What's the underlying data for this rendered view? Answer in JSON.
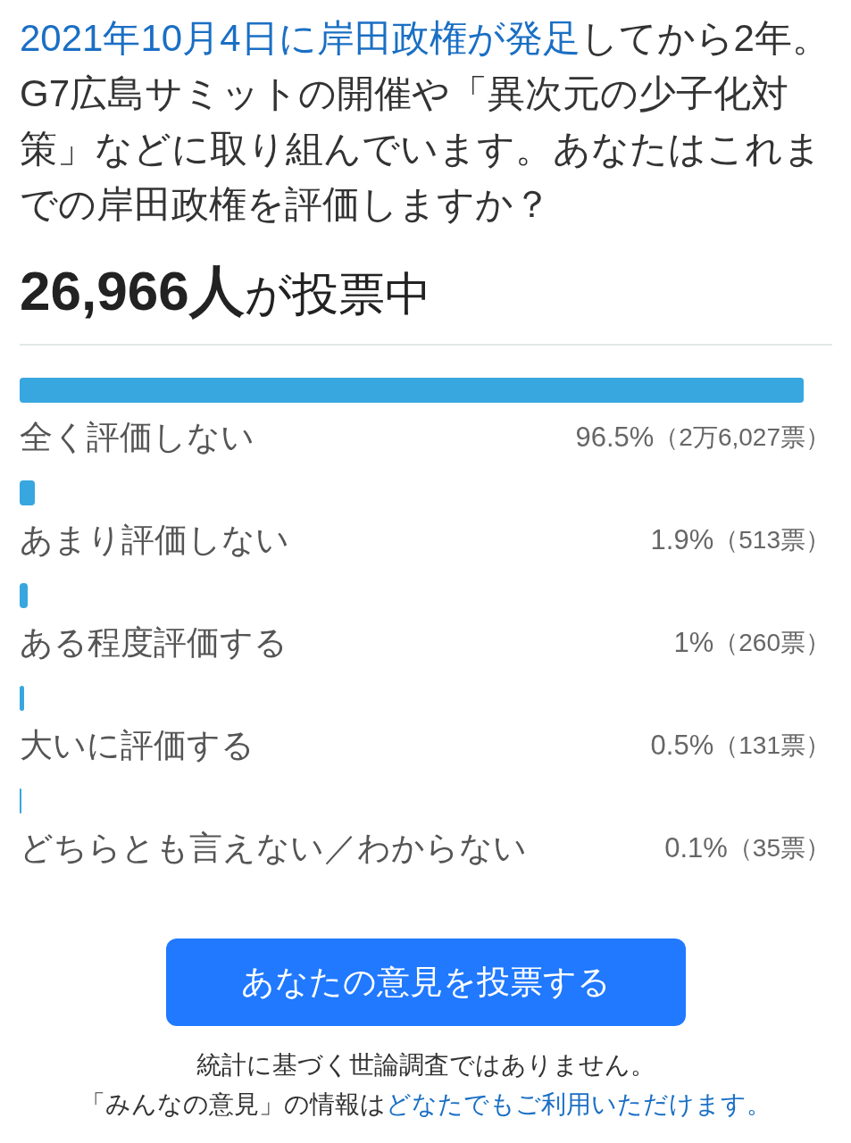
{
  "question": {
    "link": "2021年10月4日に岸田政権が発足",
    "text": "してから2年。G7広島サミットの開催や「異次元の少子化対策」などに取り組んでいます。あなたはこれまでの岸田政権を評価しますか？"
  },
  "vote_total": "**26,966人**が投票中",
  "results": [
    {
      "label": "全く評価しない",
      "level": 0.965,
      "percent": "96.5%",
      "votes": "（2万6,027票）"
    },
    {
      "label": "あまり評価しない",
      "level": 0.019,
      "percent": "1.9%",
      "votes": "（513票）"
    },
    {
      "label": "ある程度評価する",
      "level": 0.01,
      "percent": "1%",
      "votes": "（260票）"
    },
    {
      "label": "大いに評価する",
      "level": 0.005,
      "percent": "0.5%",
      "votes": "（131票）"
    },
    {
      "label": "どちらとも言えない／わからない",
      "level": 0.001,
      "percent": "0.1%",
      "votes": "（35票）"
    }
  ],
  "vote_button": "あなたの意見を投票する",
  "footer": {
    "disclaimer": "統計に基づく世論調査ではありません。",
    "notice": "「みんなの意見」の情報は",
    "link": "どなたでもご利用いただけます。"
  }
}
